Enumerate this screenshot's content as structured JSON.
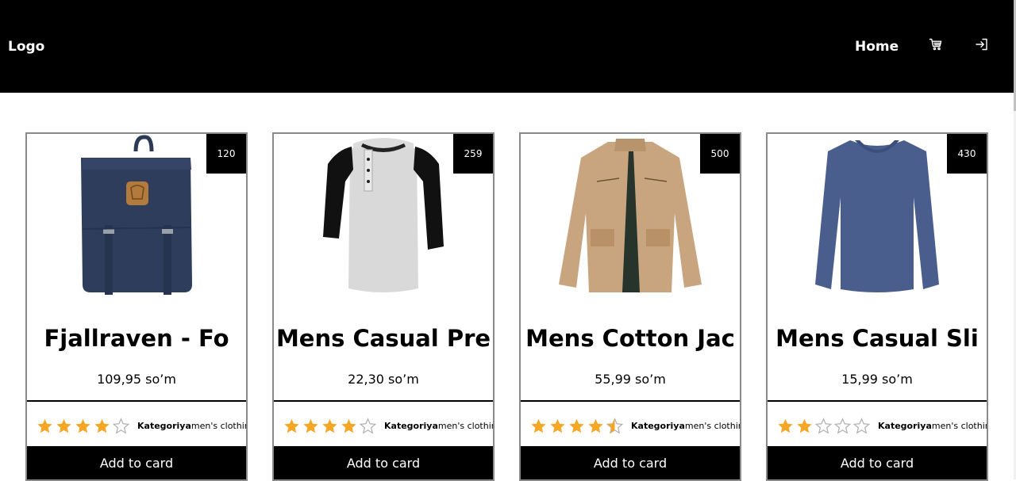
{
  "header": {
    "logo": "Logo",
    "nav_home": "Home",
    "cart_icon": "cart-icon",
    "login_icon": "login-icon",
    "background": "#000000"
  },
  "products": [
    {
      "badge": "120",
      "title": "Fjallraven - Fo",
      "price": "109,95 so’m",
      "rating": 4,
      "category_label": "Kategoriya",
      "category_value": "men's clothing",
      "button": "Add to card",
      "image": "backpack"
    },
    {
      "badge": "259",
      "title": "Mens Casual Pre",
      "price": "22,30 so’m",
      "rating": 4,
      "category_label": "Kategoriya",
      "category_value": "men's clothing",
      "button": "Add to card",
      "image": "raglan-shirt"
    },
    {
      "badge": "500",
      "title": "Mens Cotton Jac",
      "price": "55,99 so’m",
      "rating": 4.5,
      "category_label": "Kategoriya",
      "category_value": "men's clothing",
      "button": "Add to card",
      "image": "cotton-jacket"
    },
    {
      "badge": "430",
      "title": "Mens Casual Sli",
      "price": "15,99 so’m",
      "rating": 2,
      "category_label": "Kategoriya",
      "category_value": "men's clothing",
      "button": "Add to card",
      "image": "slim-tshirt"
    }
  ],
  "colors": {
    "star_filled": "#f5a623",
    "star_empty": "#b0b0b0",
    "button_bg": "#000000"
  }
}
